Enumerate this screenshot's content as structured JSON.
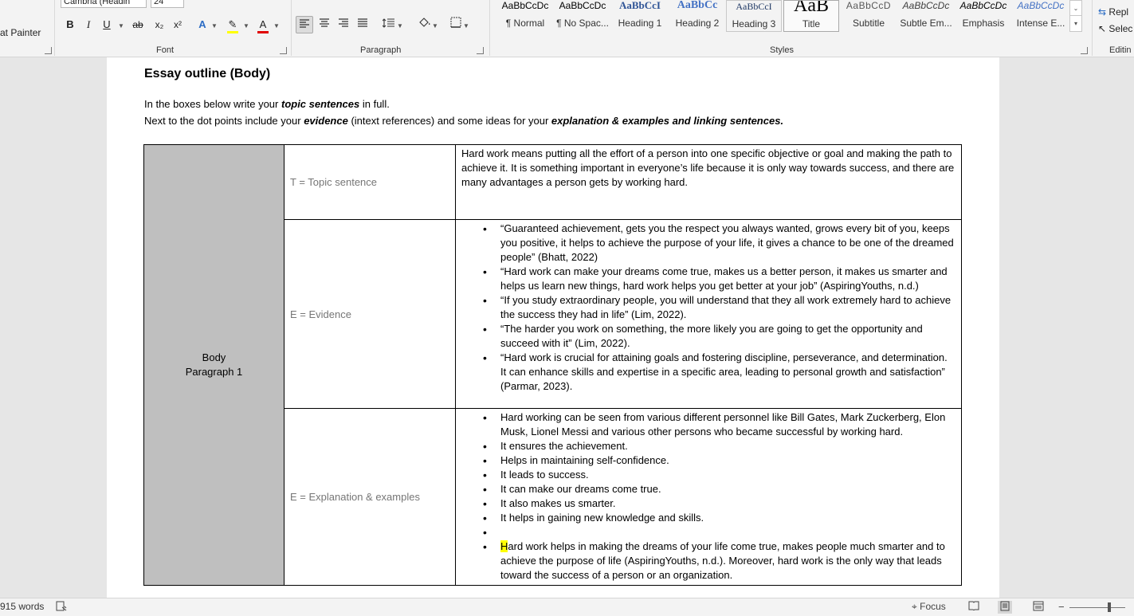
{
  "ribbon": {
    "clipboard": {
      "format_painter": "at Painter"
    },
    "font": {
      "label": "Font",
      "font_name": "Cambria (Headin",
      "font_size": "24",
      "bold": "B",
      "italic": "I",
      "underline": "U",
      "strike": "ab",
      "subscript": "x₂",
      "superscript": "x²",
      "text_effects": "A",
      "highlight": "✎",
      "font_color": "A",
      "highlight_color": "#ffff00",
      "font_color_value": "#e00000"
    },
    "paragraph": {
      "label": "Paragraph"
    },
    "styles": {
      "label": "Styles",
      "items": [
        {
          "preview": "AaBbCcDc",
          "name": "¶ Normal"
        },
        {
          "preview": "AaBbCcDc",
          "name": "¶ No Spac..."
        },
        {
          "preview": "AaBbCcI",
          "name": "Heading 1"
        },
        {
          "preview": "AaBbCc",
          "name": "Heading 2"
        },
        {
          "preview": "AaBbCcI",
          "name": "Heading 3"
        },
        {
          "preview": "AaB",
          "name": "Title"
        },
        {
          "preview": "AaBbCcD",
          "name": "Subtitle"
        },
        {
          "preview": "AaBbCcDc",
          "name": "Subtle Em..."
        },
        {
          "preview": "AaBbCcDc",
          "name": "Emphasis"
        },
        {
          "preview": "AaBbCcDc",
          "name": "Intense E..."
        }
      ]
    },
    "editing": {
      "label": "Editin",
      "replace": "Repl",
      "select": "Selec"
    }
  },
  "document": {
    "heading": "Essay outline (Body)",
    "instr1": {
      "a": "In the boxes below write your ",
      "b": "topic sentences",
      "c": " in full."
    },
    "instr2": {
      "a": "Next to the dot points include your ",
      "b": "evidence",
      "c": " (intext references) and some ideas for your ",
      "d": "explanation & examples and linking sentences."
    },
    "table": {
      "row_head_line1": "Body",
      "row_head_line2": "Paragraph 1",
      "topic": {
        "label": "T = Topic sentence",
        "text": "Hard work means putting all the effort of a person into one specific objective or goal and making the path to achieve it. It is something important in everyone’s life because it is only way towards success, and there are many advantages a person gets by working hard."
      },
      "evidence": {
        "label": "E = Evidence",
        "items": [
          "“Guaranteed achievement, gets you the respect you always wanted, grows every bit of you, keeps you positive, it helps to achieve the purpose of your life, it gives a chance to be one of the dreamed people” (Bhatt, 2022)",
          "“Hard work can make your dreams come true, makes us a better person, it makes us smarter and helps us learn new things, hard work helps you get better at your job” (AspiringYouths, n.d.)",
          "“If you study extraordinary people, you will understand that they all work extremely hard to achieve the success they had in life” (Lim, 2022).",
          "“The harder you work on something, the more likely you are going to get the opportunity and succeed with it” (Lim, 2022).",
          "“Hard work is crucial for attaining goals and fostering discipline, perseverance, and determination. It can enhance skills and expertise in a specific area, leading to personal growth and satisfaction” (Parmar, 2023)."
        ]
      },
      "explanation": {
        "label": "E = Explanation & examples",
        "items": [
          "Hard working can be seen from various different personnel like Bill Gates, Mark Zuckerberg, Elon Musk, Lionel Messi and various other persons who became successful by working hard.",
          "It ensures the achievement.",
          "Helps in maintaining self-confidence.",
          "It leads to success.",
          "It can make our dreams come true.",
          "It also makes us smarter.",
          "It helps in gaining new knowledge and skills.",
          ""
        ],
        "last_first_letter": "H",
        "last_rest": "ard work helps in making the dreams of your life come true, makes people much smarter and to achieve the purpose of life (AspiringYouths, n.d.). Moreover, hard work is the only way that leads toward the success of a person or an organization."
      }
    }
  },
  "status": {
    "words": "915 words",
    "focus": "Focus"
  }
}
